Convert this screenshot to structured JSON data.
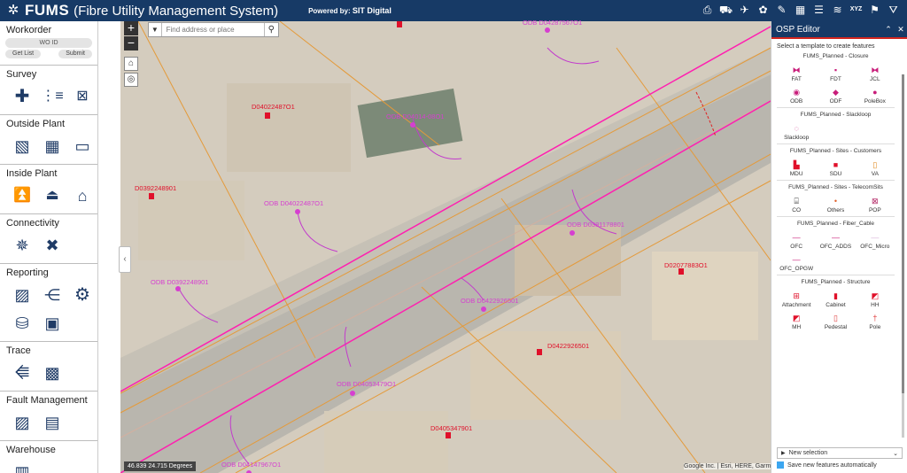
{
  "app": {
    "title": "FUMS",
    "subtitle": "(Fibre Utility Management System)",
    "powered_by": "Powered by:",
    "powered_company": "SIT Digital",
    "toolbar_icons": [
      "printer-icon",
      "car-icon",
      "bird-icon",
      "palette-icon",
      "pencil-icon",
      "grid-icon",
      "list-icon",
      "layers-icon",
      "xyz-icon",
      "bookmark-icon",
      "filter-icon"
    ],
    "toolbar_xyz": "XYZ"
  },
  "sidebar": {
    "workorder": {
      "title": "Workorder",
      "wo_id_placeholder": "WO ID",
      "get_list": "Get List",
      "submit": "Submit"
    },
    "survey": {
      "title": "Survey"
    },
    "outside_plant": {
      "title": "Outside Plant"
    },
    "inside_plant": {
      "title": "Inside Plant"
    },
    "connectivity": {
      "title": "Connectivity"
    },
    "reporting": {
      "title": "Reporting"
    },
    "trace": {
      "title": "Trace"
    },
    "fault_management": {
      "title": "Fault Management"
    },
    "warehouse": {
      "title": "Warehouse"
    }
  },
  "map": {
    "search_placeholder": "Find address or place",
    "coordinates": "46.839 24.715 Degrees",
    "attribution": "Google Inc. | Esri, HERE, Garm",
    "labels_odb": [
      "ODB D04287567O1",
      "ODB D04014-08O1",
      "ODB D04022487O1",
      "ODB D0381178801",
      "ODB D0392248901",
      "ODB D0422926501",
      "ODB D04053479O1",
      "ODB D04147967O1"
    ],
    "labels_site": [
      "D04022487O1",
      "D0392248901",
      "D02077883O1",
      "D0422926501",
      "D0405347901"
    ]
  },
  "panel": {
    "title": "OSP Editor",
    "hint": "Select a template to create features",
    "groups": [
      {
        "title": "FUMS_Planned - Closure",
        "items": [
          "FAT",
          "FDT",
          "JCL",
          "ODB",
          "ODF",
          "PoleBox"
        ]
      },
      {
        "title": "FUMS_Planned - Slackloop",
        "items": [
          "Slackloop"
        ]
      },
      {
        "title": "FUMS_Planned - Sites - Customers",
        "items": [
          "MDU",
          "SDU",
          "VA"
        ]
      },
      {
        "title": "FUMS_Planned - Sites - TelecomSits",
        "items": [
          "CO",
          "Others",
          "POP"
        ]
      },
      {
        "title": "FUMS_Planned - Fiber_Cable",
        "items": [
          "OFC",
          "OFC_ADDS",
          "OFC_Micro",
          "OFC_OPGW"
        ]
      },
      {
        "title": "FUMS_Planned - Structure",
        "items": [
          "Attachment",
          "Cabinet",
          "HH",
          "MH",
          "Pedestal",
          "Pole"
        ]
      }
    ],
    "new_selection": "New selection",
    "auto_save": "Save new features automatically"
  }
}
